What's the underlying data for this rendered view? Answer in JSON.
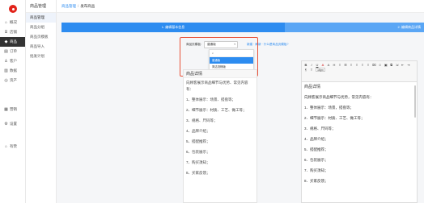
{
  "sidebar": {
    "items": [
      {
        "label": "概况",
        "icon": "home-icon"
      },
      {
        "label": "店铺",
        "icon": "shop-icon"
      },
      {
        "label": "商品",
        "icon": "goods-icon"
      },
      {
        "label": "订单",
        "icon": "order-icon"
      },
      {
        "label": "客户",
        "icon": "user-icon"
      },
      {
        "label": "数据",
        "icon": "chart-icon"
      },
      {
        "label": "资产",
        "icon": "wallet-icon"
      },
      {
        "label": "营销",
        "icon": "marketing-icon"
      },
      {
        "label": "设置",
        "icon": "gear-icon"
      },
      {
        "label": "有赞",
        "icon": "app-icon"
      }
    ]
  },
  "subbar": {
    "title": "商品管理",
    "items": [
      "商品管理",
      "商品分组",
      "商品页模板",
      "商品导入",
      "批发计划"
    ]
  },
  "breadcrumb": {
    "parent": "商品管理",
    "sep": "/",
    "current": "发布商品"
  },
  "steps": {
    "one": "1. 编辑基本信息",
    "two": "2. 编辑商品详情"
  },
  "form": {
    "label": "商品页模板:",
    "select_value": "普通版",
    "hint": "新建 · 刷新 · 什么是商品页模板?"
  },
  "dropdown": {
    "search_placeholder": "",
    "options": [
      "普通版",
      "简洁流畅版"
    ]
  },
  "preview": {
    "title": "商品详情",
    "lines": [
      "向顾客展示商品细节与优势、常见内容有：",
      "1、整体展示：场景、搭盘等；",
      "2、细节展示：材质、工艺、做工等；",
      "3、规格、尺码等；",
      "4、品牌介绍；",
      "5、搭配推荐；",
      "6、包装展示；",
      "7、购买须知；",
      "8、买家反馈；"
    ]
  },
  "editor": {
    "toolbar": [
      "B",
      "I",
      "U",
      "A",
      "A",
      "H",
      "≡",
      "☰",
      "≡",
      "≡",
      "≡",
      "≡",
      "⌧",
      "☺",
      "▣",
      "⧉",
      "⇲",
      "⇤",
      "⇥",
      "¶",
      "T",
      "16px"
    ],
    "title": "商品详情",
    "lines": [
      "向顾客展示商品细节与优势，常见内容有：",
      "1．整体展示：场景，搭盘等；",
      "2．细节展示：材质、工艺、做工等；",
      "3．规格、尺码等；",
      "4．品牌介绍；",
      "5．搭配推荐；",
      "6．包装展示；",
      "7．购买须知；",
      "8．买家反馈；"
    ]
  },
  "colors": {
    "accent": "#2d8cf0",
    "highlight": "#e8533a",
    "brand": "#e2231a"
  }
}
